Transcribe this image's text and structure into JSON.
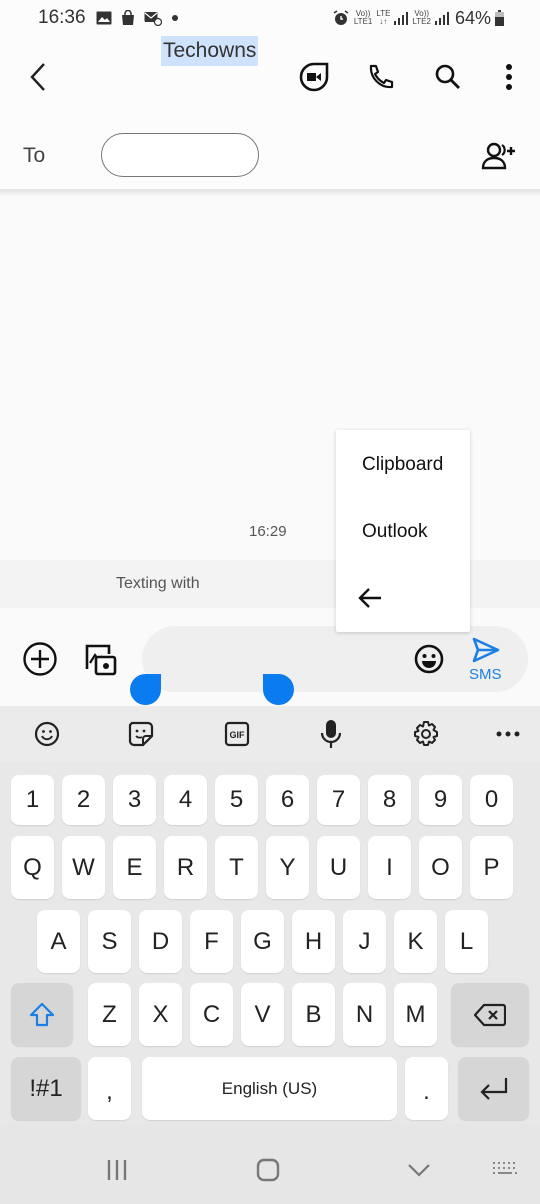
{
  "status_bar": {
    "time": "16:36",
    "left_icons": [
      "gallery-icon",
      "shopping-bag-icon",
      "sync-mail-icon",
      "dot-icon"
    ],
    "sim1": "LTE1",
    "sim1_volte": "Vo))",
    "lte_label": "LTE",
    "sim2": "LTE2",
    "sim2_volte": "Vo))",
    "battery": "64%"
  },
  "app_bar": {
    "back_icon": "chevron-left-icon",
    "actions": [
      "video-call-icon",
      "phone-icon",
      "search-icon",
      "more-vert-icon"
    ]
  },
  "recipient": {
    "to_label": "To",
    "field_value": "",
    "add_contact_icon": "add-contact-icon"
  },
  "conversation": {
    "timestamp": "16:29",
    "texting_with": "Texting with"
  },
  "popup_menu": {
    "items": [
      "Clipboard",
      "Outlook"
    ],
    "back_icon": "arrow-left-icon"
  },
  "composer": {
    "message_text": "Techowns",
    "send_label": "SMS",
    "accent_color": "#1b7fe5",
    "selection_color": "#cfe2fb",
    "handle_color": "#0a7cf0"
  },
  "keyboard_toolbar": [
    "emoji-icon",
    "sticker-icon",
    "gif-icon",
    "mic-icon",
    "settings-icon",
    "more-horiz-icon"
  ],
  "keyboard": {
    "row_numbers": [
      "1",
      "2",
      "3",
      "4",
      "5",
      "6",
      "7",
      "8",
      "9",
      "0"
    ],
    "row1": [
      "Q",
      "W",
      "E",
      "R",
      "T",
      "Y",
      "U",
      "I",
      "O",
      "P"
    ],
    "row2": [
      "A",
      "S",
      "D",
      "F",
      "G",
      "H",
      "J",
      "K",
      "L"
    ],
    "row3": [
      "Z",
      "X",
      "C",
      "V",
      "B",
      "N",
      "M"
    ],
    "symbols_label": "!#1",
    "comma": ",",
    "space_label": "English (US)",
    "period": "."
  },
  "nav_bar": [
    "recents-icon",
    "home-icon",
    "hide-keyboard-icon",
    "keyboard-switch-icon"
  ]
}
